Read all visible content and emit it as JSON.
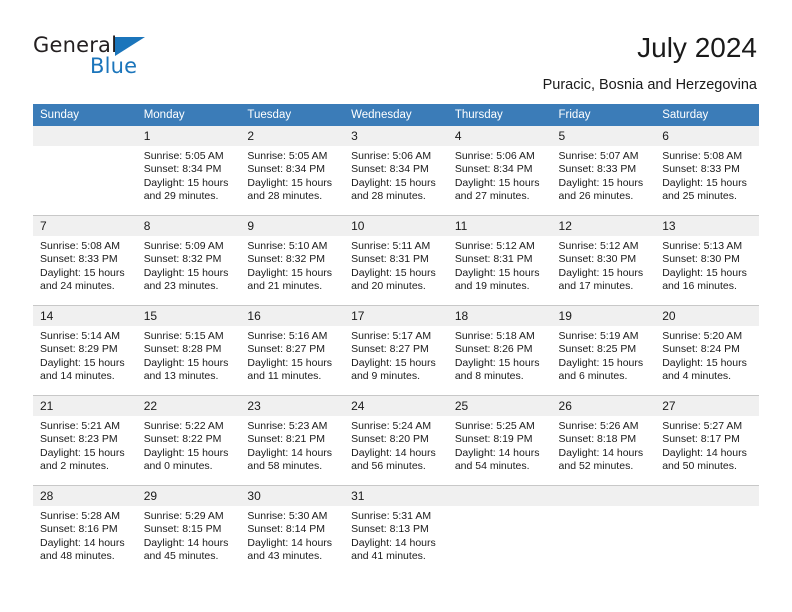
{
  "brand": {
    "name_top": "General",
    "name_bottom": "Blue",
    "accent_color": "#1b75bb"
  },
  "header": {
    "title": "July 2024",
    "subtitle": "Puracic, Bosnia and Herzegovina",
    "header_bar_color": "#3b7cb8",
    "daynum_band_color": "#f0f0f0"
  },
  "calendar": {
    "weekday_headers": [
      "Sunday",
      "Monday",
      "Tuesday",
      "Wednesday",
      "Thursday",
      "Friday",
      "Saturday"
    ],
    "labels": {
      "sunrise_prefix": "Sunrise:",
      "sunset_prefix": "Sunset:",
      "daylight_prefix": "Daylight:"
    },
    "weeks": [
      [
        {
          "day": "",
          "blank": true,
          "sunrise": "",
          "sunset": "",
          "daylight_line1": "",
          "daylight_line2": ""
        },
        {
          "day": "1",
          "sunrise": "Sunrise: 5:05 AM",
          "sunset": "Sunset: 8:34 PM",
          "daylight_line1": "Daylight: 15 hours",
          "daylight_line2": "and 29 minutes."
        },
        {
          "day": "2",
          "sunrise": "Sunrise: 5:05 AM",
          "sunset": "Sunset: 8:34 PM",
          "daylight_line1": "Daylight: 15 hours",
          "daylight_line2": "and 28 minutes."
        },
        {
          "day": "3",
          "sunrise": "Sunrise: 5:06 AM",
          "sunset": "Sunset: 8:34 PM",
          "daylight_line1": "Daylight: 15 hours",
          "daylight_line2": "and 28 minutes."
        },
        {
          "day": "4",
          "sunrise": "Sunrise: 5:06 AM",
          "sunset": "Sunset: 8:34 PM",
          "daylight_line1": "Daylight: 15 hours",
          "daylight_line2": "and 27 minutes."
        },
        {
          "day": "5",
          "sunrise": "Sunrise: 5:07 AM",
          "sunset": "Sunset: 8:33 PM",
          "daylight_line1": "Daylight: 15 hours",
          "daylight_line2": "and 26 minutes."
        },
        {
          "day": "6",
          "sunrise": "Sunrise: 5:08 AM",
          "sunset": "Sunset: 8:33 PM",
          "daylight_line1": "Daylight: 15 hours",
          "daylight_line2": "and 25 minutes."
        }
      ],
      [
        {
          "day": "7",
          "sunrise": "Sunrise: 5:08 AM",
          "sunset": "Sunset: 8:33 PM",
          "daylight_line1": "Daylight: 15 hours",
          "daylight_line2": "and 24 minutes."
        },
        {
          "day": "8",
          "sunrise": "Sunrise: 5:09 AM",
          "sunset": "Sunset: 8:32 PM",
          "daylight_line1": "Daylight: 15 hours",
          "daylight_line2": "and 23 minutes."
        },
        {
          "day": "9",
          "sunrise": "Sunrise: 5:10 AM",
          "sunset": "Sunset: 8:32 PM",
          "daylight_line1": "Daylight: 15 hours",
          "daylight_line2": "and 21 minutes."
        },
        {
          "day": "10",
          "sunrise": "Sunrise: 5:11 AM",
          "sunset": "Sunset: 8:31 PM",
          "daylight_line1": "Daylight: 15 hours",
          "daylight_line2": "and 20 minutes."
        },
        {
          "day": "11",
          "sunrise": "Sunrise: 5:12 AM",
          "sunset": "Sunset: 8:31 PM",
          "daylight_line1": "Daylight: 15 hours",
          "daylight_line2": "and 19 minutes."
        },
        {
          "day": "12",
          "sunrise": "Sunrise: 5:12 AM",
          "sunset": "Sunset: 8:30 PM",
          "daylight_line1": "Daylight: 15 hours",
          "daylight_line2": "and 17 minutes."
        },
        {
          "day": "13",
          "sunrise": "Sunrise: 5:13 AM",
          "sunset": "Sunset: 8:30 PM",
          "daylight_line1": "Daylight: 15 hours",
          "daylight_line2": "and 16 minutes."
        }
      ],
      [
        {
          "day": "14",
          "sunrise": "Sunrise: 5:14 AM",
          "sunset": "Sunset: 8:29 PM",
          "daylight_line1": "Daylight: 15 hours",
          "daylight_line2": "and 14 minutes."
        },
        {
          "day": "15",
          "sunrise": "Sunrise: 5:15 AM",
          "sunset": "Sunset: 8:28 PM",
          "daylight_line1": "Daylight: 15 hours",
          "daylight_line2": "and 13 minutes."
        },
        {
          "day": "16",
          "sunrise": "Sunrise: 5:16 AM",
          "sunset": "Sunset: 8:27 PM",
          "daylight_line1": "Daylight: 15 hours",
          "daylight_line2": "and 11 minutes."
        },
        {
          "day": "17",
          "sunrise": "Sunrise: 5:17 AM",
          "sunset": "Sunset: 8:27 PM",
          "daylight_line1": "Daylight: 15 hours",
          "daylight_line2": "and 9 minutes."
        },
        {
          "day": "18",
          "sunrise": "Sunrise: 5:18 AM",
          "sunset": "Sunset: 8:26 PM",
          "daylight_line1": "Daylight: 15 hours",
          "daylight_line2": "and 8 minutes."
        },
        {
          "day": "19",
          "sunrise": "Sunrise: 5:19 AM",
          "sunset": "Sunset: 8:25 PM",
          "daylight_line1": "Daylight: 15 hours",
          "daylight_line2": "and 6 minutes."
        },
        {
          "day": "20",
          "sunrise": "Sunrise: 5:20 AM",
          "sunset": "Sunset: 8:24 PM",
          "daylight_line1": "Daylight: 15 hours",
          "daylight_line2": "and 4 minutes."
        }
      ],
      [
        {
          "day": "21",
          "sunrise": "Sunrise: 5:21 AM",
          "sunset": "Sunset: 8:23 PM",
          "daylight_line1": "Daylight: 15 hours",
          "daylight_line2": "and 2 minutes."
        },
        {
          "day": "22",
          "sunrise": "Sunrise: 5:22 AM",
          "sunset": "Sunset: 8:22 PM",
          "daylight_line1": "Daylight: 15 hours",
          "daylight_line2": "and 0 minutes."
        },
        {
          "day": "23",
          "sunrise": "Sunrise: 5:23 AM",
          "sunset": "Sunset: 8:21 PM",
          "daylight_line1": "Daylight: 14 hours",
          "daylight_line2": "and 58 minutes."
        },
        {
          "day": "24",
          "sunrise": "Sunrise: 5:24 AM",
          "sunset": "Sunset: 8:20 PM",
          "daylight_line1": "Daylight: 14 hours",
          "daylight_line2": "and 56 minutes."
        },
        {
          "day": "25",
          "sunrise": "Sunrise: 5:25 AM",
          "sunset": "Sunset: 8:19 PM",
          "daylight_line1": "Daylight: 14 hours",
          "daylight_line2": "and 54 minutes."
        },
        {
          "day": "26",
          "sunrise": "Sunrise: 5:26 AM",
          "sunset": "Sunset: 8:18 PM",
          "daylight_line1": "Daylight: 14 hours",
          "daylight_line2": "and 52 minutes."
        },
        {
          "day": "27",
          "sunrise": "Sunrise: 5:27 AM",
          "sunset": "Sunset: 8:17 PM",
          "daylight_line1": "Daylight: 14 hours",
          "daylight_line2": "and 50 minutes."
        }
      ],
      [
        {
          "day": "28",
          "sunrise": "Sunrise: 5:28 AM",
          "sunset": "Sunset: 8:16 PM",
          "daylight_line1": "Daylight: 14 hours",
          "daylight_line2": "and 48 minutes."
        },
        {
          "day": "29",
          "sunrise": "Sunrise: 5:29 AM",
          "sunset": "Sunset: 8:15 PM",
          "daylight_line1": "Daylight: 14 hours",
          "daylight_line2": "and 45 minutes."
        },
        {
          "day": "30",
          "sunrise": "Sunrise: 5:30 AM",
          "sunset": "Sunset: 8:14 PM",
          "daylight_line1": "Daylight: 14 hours",
          "daylight_line2": "and 43 minutes."
        },
        {
          "day": "31",
          "sunrise": "Sunrise: 5:31 AM",
          "sunset": "Sunset: 8:13 PM",
          "daylight_line1": "Daylight: 14 hours",
          "daylight_line2": "and 41 minutes."
        },
        {
          "day": "",
          "blank": true,
          "sunrise": "",
          "sunset": "",
          "daylight_line1": "",
          "daylight_line2": ""
        },
        {
          "day": "",
          "blank": true,
          "sunrise": "",
          "sunset": "",
          "daylight_line1": "",
          "daylight_line2": ""
        },
        {
          "day": "",
          "blank": true,
          "sunrise": "",
          "sunset": "",
          "daylight_line1": "",
          "daylight_line2": ""
        }
      ]
    ]
  }
}
